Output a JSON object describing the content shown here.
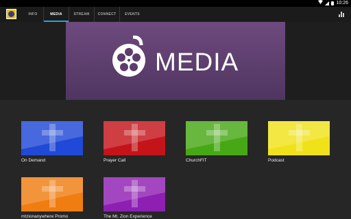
{
  "status": {
    "time": "10:26"
  },
  "tabs": [
    {
      "label": "INFO",
      "active": false
    },
    {
      "label": "MEDIA",
      "active": true
    },
    {
      "label": "STREAM",
      "active": false
    },
    {
      "label": "CONNECT",
      "active": false
    },
    {
      "label": "EVENTS",
      "active": false
    }
  ],
  "banner": {
    "title": "MEDIA",
    "icon": "film-reel-icon",
    "colors": [
      "#6e4a7e",
      "#4f3560"
    ]
  },
  "tiles": [
    {
      "label": "On Demand",
      "color": "#1f49d6"
    },
    {
      "label": "Prayer Call",
      "color": "#c4141a"
    },
    {
      "label": "ChurchFIT",
      "color": "#47a815"
    },
    {
      "label": "Podcast",
      "color": "#f0e21a"
    },
    {
      "label": "mtzionanywhere Promo",
      "color": "#f07d10"
    },
    {
      "label": "The Mt. Zion Experience",
      "color": "#8e1fb3"
    }
  ],
  "accent": "#2aa6d8"
}
